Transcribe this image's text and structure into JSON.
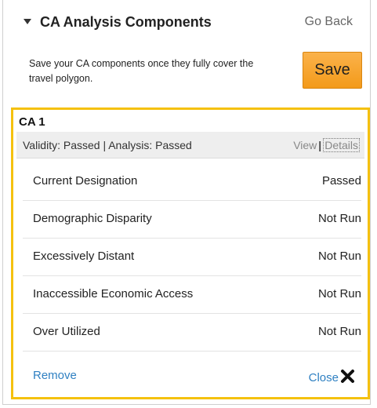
{
  "header": {
    "title": "CA Analysis Components",
    "go_back": "Go Back"
  },
  "description": "Save your CA components once they fully cover the travel polygon.",
  "save_label": "Save",
  "ca": {
    "title": "CA 1",
    "status": "Validity: Passed | Analysis: Passed",
    "view_label": "View",
    "separator": "|",
    "details_label": "Details",
    "rows": [
      {
        "label": "Current Designation",
        "value": "Passed"
      },
      {
        "label": "Demographic Disparity",
        "value": "Not Run"
      },
      {
        "label": "Excessively Distant",
        "value": "Not Run"
      },
      {
        "label": "Inaccessible Economic Access",
        "value": "Not Run"
      },
      {
        "label": "Over Utilized",
        "value": "Not Run"
      }
    ],
    "remove_label": "Remove",
    "close_label": "Close"
  },
  "colors": {
    "accent_border": "#f5c10f",
    "save_button": "#f39a1a",
    "link": "#2f80c2"
  },
  "icons": {
    "collapse": "caret-down-icon",
    "close": "close-x-icon"
  }
}
